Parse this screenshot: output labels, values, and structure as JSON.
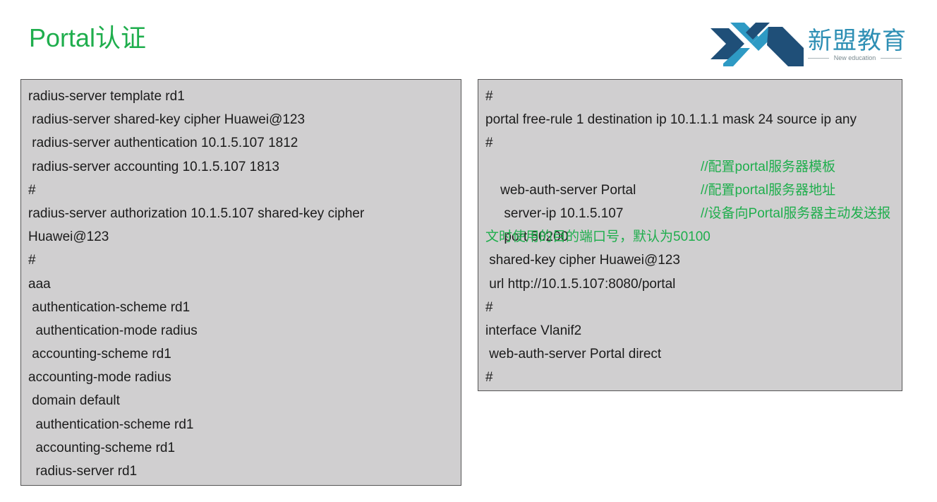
{
  "title": "Portal认证",
  "logo": {
    "name": "新盟教育",
    "subtitle": "New education",
    "colors": {
      "dark": "#1f4f78",
      "light": "#2e9ac4"
    }
  },
  "left_panel": {
    "lines": [
      "radius-server template rd1",
      " radius-server shared-key cipher Huawei@123",
      " radius-server authentication 10.1.5.107 1812",
      " radius-server accounting 10.1.5.107 1813",
      "#",
      "radius-server authorization 10.1.5.107 shared-key cipher",
      "Huawei@123",
      "#",
      "aaa",
      " authentication-scheme rd1",
      "  authentication-mode radius",
      " accounting-scheme rd1",
      "accounting-mode radius",
      " domain default",
      "  authentication-scheme rd1",
      "  accounting-scheme rd1",
      "  radius-server rd1"
    ]
  },
  "right_panel": {
    "line1": "#",
    "line2": "portal free-rule 1 destination ip 10.1.1.1 mask 24 source ip any",
    "line3": "#",
    "line4": "web-auth-server Portal",
    "comment4": "//配置portal服务器模板",
    "line5": " server-ip 10.1.5.107",
    "comment5": "//配置portal服务器地址",
    "line6": " port 50200",
    "comment6": "//设备向Portal服务器主动发送报",
    "line7": "文时使用的目的端口号，默认为50100",
    "line8": " shared-key cipher Huawei@123",
    "line9": " url http://10.1.5.107:8080/portal",
    "line10": "#",
    "line11": "interface Vlanif2",
    "line12": " web-auth-server Portal direct",
    "line13": "#"
  },
  "colors": {
    "accent": "#1fae4d",
    "panel_bg": "#d0cfd0",
    "text": "#1b1b1b"
  }
}
